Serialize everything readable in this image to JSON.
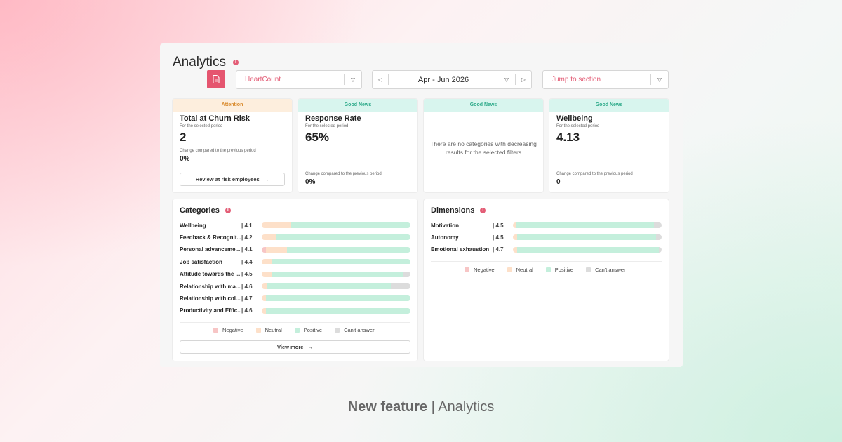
{
  "header": {
    "title": "Analytics",
    "company_select": "HeartCount",
    "period": "Apr - Jun 2026",
    "jump_select": "Jump to section"
  },
  "cards": [
    {
      "tag": "Attention",
      "title": "Total at Churn Risk",
      "sub": "For the selected period",
      "value": "2",
      "change_label": "Change compared to the previous period",
      "change": "0%",
      "button": "Review at risk employees"
    },
    {
      "tag": "Good News",
      "title": "Response Rate",
      "sub": "For the selected period",
      "value": "65%",
      "change_label": "Change compared to the previous period",
      "change": "0%"
    },
    {
      "tag": "Good News",
      "message": "There are no categories with decreasing results for the selected filters"
    },
    {
      "tag": "Good News",
      "title": "Wellbeing",
      "sub": "For the selected period",
      "value": "4.13",
      "change_label": "Change compared to the previous period",
      "change": "0"
    }
  ],
  "categories": {
    "title": "Categories",
    "items": [
      {
        "label": "Wellbeing",
        "score": "4.1",
        "neg": 0.0,
        "neu": 0.2,
        "pos": 0.8,
        "na": 0.0
      },
      {
        "label": "Feedback & Recognit...",
        "score": "4.2",
        "neg": 0.0,
        "neu": 0.1,
        "pos": 0.9,
        "na": 0.0
      },
      {
        "label": "Personal advanceme...",
        "score": "4.1",
        "neg": 0.03,
        "neu": 0.14,
        "pos": 0.83,
        "na": 0.0
      },
      {
        "label": "Job satisfaction",
        "score": "4.4",
        "neg": 0.0,
        "neu": 0.07,
        "pos": 0.93,
        "na": 0.0
      },
      {
        "label": "Attitude towards the ...",
        "score": "4.5",
        "neg": 0.0,
        "neu": 0.07,
        "pos": 0.88,
        "na": 0.05
      },
      {
        "label": "Relationship with ma...",
        "score": "4.6",
        "neg": 0.0,
        "neu": 0.04,
        "pos": 0.83,
        "na": 0.13
      },
      {
        "label": "Relationship with col...",
        "score": "4.7",
        "neg": 0.0,
        "neu": 0.03,
        "pos": 0.97,
        "na": 0.0
      },
      {
        "label": "Productivity and Effic...",
        "score": "4.6",
        "neg": 0.0,
        "neu": 0.03,
        "pos": 0.97,
        "na": 0.0
      }
    ],
    "view_more": "View more"
  },
  "dimensions": {
    "title": "Dimensions",
    "items": [
      {
        "label": "Motivation",
        "score": "4.5",
        "neg": 0.0,
        "neu": 0.02,
        "pos": 0.93,
        "na": 0.05
      },
      {
        "label": "Autonomy",
        "score": "4.5",
        "neg": 0.0,
        "neu": 0.03,
        "pos": 0.93,
        "na": 0.04
      },
      {
        "label": "Emotional exhaustion",
        "score": "4.7",
        "neg": 0.0,
        "neu": 0.03,
        "pos": 0.95,
        "na": 0.02
      }
    ]
  },
  "legend": [
    "Negative",
    "Neutral",
    "Positive",
    "Can't answer"
  ],
  "colors": {
    "negative": "#f7c5c5",
    "neutral": "#fde0c9",
    "positive": "#c4efdc",
    "na": "#dcdcdc",
    "accent": "#e5556f"
  },
  "footer": {
    "bold": "New feature",
    "sep": " | ",
    "rest": "Analytics"
  }
}
